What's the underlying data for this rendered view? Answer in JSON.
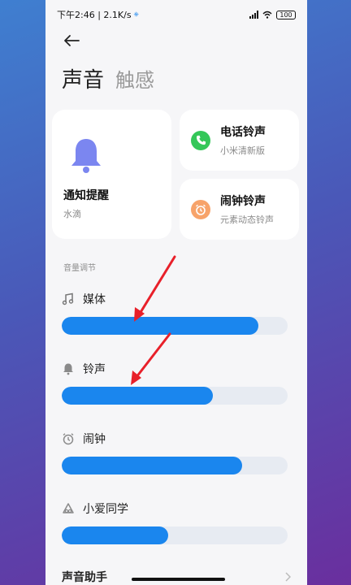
{
  "status_bar": {
    "time_speed": "下午2:46 | 2.1K/s",
    "battery": "100"
  },
  "header": {
    "tabs": [
      {
        "label": "声音",
        "active": true
      },
      {
        "label": "触感",
        "active": false
      }
    ]
  },
  "cards": {
    "notification": {
      "title": "通知提醒",
      "subtitle": "水滴",
      "icon": "bell-icon",
      "color": "#7b86f0"
    },
    "ringtone": {
      "title": "电话铃声",
      "subtitle": "小米清新版",
      "icon": "phone-icon",
      "color": "#34c759"
    },
    "alarm": {
      "title": "闹钟铃声",
      "subtitle": "元素动态铃声",
      "icon": "alarm-clock-icon",
      "color": "#f7a36a"
    }
  },
  "volume": {
    "section_label": "音量调节",
    "items": [
      {
        "label": "媒体",
        "icon": "music-note-icon",
        "level": 0.87
      },
      {
        "label": "铃声",
        "icon": "bell-icon",
        "level": 0.67
      },
      {
        "label": "闹钟",
        "icon": "alarm-clock-icon",
        "level": 0.8
      },
      {
        "label": "小爱同学",
        "icon": "xiaoai-icon",
        "level": 0.47
      }
    ]
  },
  "assistant": {
    "label": "声音助手"
  },
  "colors": {
    "accent": "#1a86ee",
    "annotation_arrow": "#e8202a"
  }
}
